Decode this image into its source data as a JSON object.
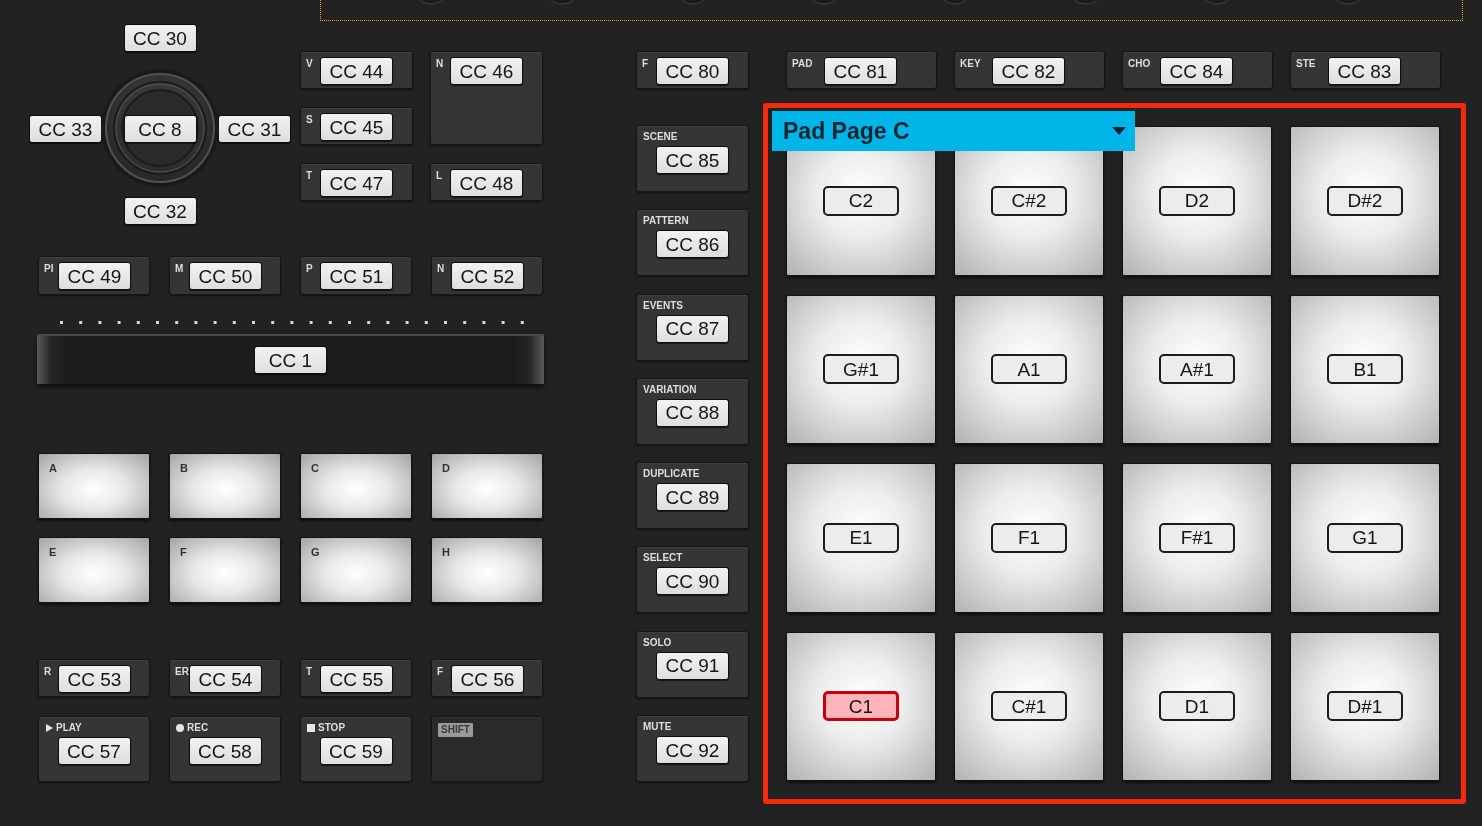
{
  "encoder": {
    "up": "CC 30",
    "left": "CC 33",
    "center": "CC 8",
    "right": "CC 31",
    "down": "CC 32"
  },
  "encoder_buttons": [
    {
      "caption": "V",
      "cc": "CC 44",
      "kind": "single"
    },
    {
      "caption": "N",
      "cc": "CC 46",
      "kind": "double"
    },
    {
      "caption": "S",
      "cc": "CC 45",
      "kind": "single"
    },
    {
      "caption": "T",
      "cc": "CC 47",
      "kind": "single"
    },
    {
      "caption": "L",
      "cc": "CC 48",
      "kind": "single"
    }
  ],
  "group_buttons": [
    {
      "caption": "PI",
      "cc": "CC 49"
    },
    {
      "caption": "M",
      "cc": "CC 50"
    },
    {
      "caption": "P",
      "cc": "CC 51"
    },
    {
      "caption": "N",
      "cc": "CC 52"
    }
  ],
  "touch_strip": {
    "cc": "CC 1"
  },
  "group_pads": [
    "A",
    "B",
    "C",
    "D",
    "E",
    "F",
    "G",
    "H"
  ],
  "function_buttons": [
    {
      "caption": "R",
      "cc": "CC 53"
    },
    {
      "caption": "ER",
      "cc": "CC 54"
    },
    {
      "caption": "T",
      "cc": "CC 55"
    },
    {
      "caption": "F",
      "cc": "CC 56"
    }
  ],
  "transport_buttons": [
    {
      "kind": "play",
      "caption": "PLAY",
      "cc": "CC 57"
    },
    {
      "kind": "rec",
      "caption": "REC",
      "cc": "CC 58"
    },
    {
      "kind": "stop",
      "caption": "STOP",
      "cc": "CC 59"
    },
    {
      "kind": "shift",
      "caption": "SHIFT"
    }
  ],
  "mode_column": [
    {
      "caption": "F",
      "cc": "CC 80",
      "kind": "inline"
    },
    {
      "caption": "SCENE",
      "cc": "CC 85",
      "kind": "stacked"
    },
    {
      "caption": "PATTERN",
      "cc": "CC 86",
      "kind": "stacked"
    },
    {
      "caption": "EVENTS",
      "cc": "CC 87",
      "kind": "stacked"
    },
    {
      "caption": "VARIATION",
      "cc": "CC 88",
      "kind": "stacked"
    },
    {
      "caption": "DUPLICATE",
      "cc": "CC 89",
      "kind": "stacked"
    },
    {
      "caption": "SELECT",
      "cc": "CC 90",
      "kind": "stacked"
    },
    {
      "caption": "SOLO",
      "cc": "CC 91",
      "kind": "stacked"
    },
    {
      "caption": "MUTE",
      "cc": "CC 92",
      "kind": "stacked"
    }
  ],
  "pad_mode_buttons": [
    {
      "caption": "PAD",
      "cc": "CC 81"
    },
    {
      "caption": "KEY",
      "cc": "CC 82"
    },
    {
      "caption": "CHO",
      "cc": "CC 84"
    },
    {
      "caption": "STE",
      "cc": "CC 83"
    }
  ],
  "pad_page": {
    "title": "Pad Page C",
    "pads": [
      {
        "note": "C2",
        "selected": false
      },
      {
        "note": "C#2",
        "selected": false
      },
      {
        "note": "D2",
        "selected": false
      },
      {
        "note": "D#2",
        "selected": false
      },
      {
        "note": "G#1",
        "selected": false
      },
      {
        "note": "A1",
        "selected": false
      },
      {
        "note": "A#1",
        "selected": false
      },
      {
        "note": "B1",
        "selected": false
      },
      {
        "note": "E1",
        "selected": false
      },
      {
        "note": "F1",
        "selected": false
      },
      {
        "note": "F#1",
        "selected": false
      },
      {
        "note": "G1",
        "selected": false
      },
      {
        "note": "C1",
        "selected": true
      },
      {
        "note": "C#1",
        "selected": false
      },
      {
        "note": "D1",
        "selected": false
      },
      {
        "note": "D#1",
        "selected": false
      }
    ]
  }
}
